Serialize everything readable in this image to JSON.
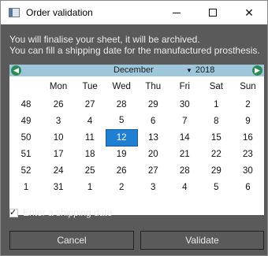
{
  "window": {
    "title": "Order validation",
    "controls": {
      "minimize": "—",
      "maximize": "☐",
      "close": "✕"
    }
  },
  "message": {
    "line1": "You will finalise your sheet, it will be archived.",
    "line2": "You can fill a shipping date for the manufactured prosthesis."
  },
  "calendar": {
    "month": "December",
    "year": "2018",
    "prev_icon": "◀",
    "next_icon": "▶",
    "weekday_headers": [
      "Mon",
      "Tue",
      "Wed",
      "Thu",
      "Fri",
      "Sat",
      "Sun"
    ],
    "weeks": [
      {
        "week": "48",
        "days": [
          "26",
          "27",
          "28",
          "29",
          "30",
          "1",
          "2"
        ]
      },
      {
        "week": "49",
        "days": [
          "3",
          "4",
          "5",
          "6",
          "7",
          "8",
          "9"
        ]
      },
      {
        "week": "50",
        "days": [
          "10",
          "11",
          "12",
          "13",
          "14",
          "15",
          "16"
        ]
      },
      {
        "week": "51",
        "days": [
          "17",
          "18",
          "19",
          "20",
          "21",
          "22",
          "23"
        ]
      },
      {
        "week": "52",
        "days": [
          "24",
          "25",
          "26",
          "27",
          "28",
          "29",
          "30"
        ]
      },
      {
        "week": "1",
        "days": [
          "31",
          "1",
          "2",
          "3",
          "4",
          "5",
          "6"
        ]
      }
    ],
    "selected_date": "12",
    "selected_color": "#1f7fd2"
  },
  "shipping": {
    "checkbox_label": "Enter a shipping date",
    "checked": true
  },
  "buttons": {
    "cancel": "Cancel",
    "validate": "Validate"
  }
}
